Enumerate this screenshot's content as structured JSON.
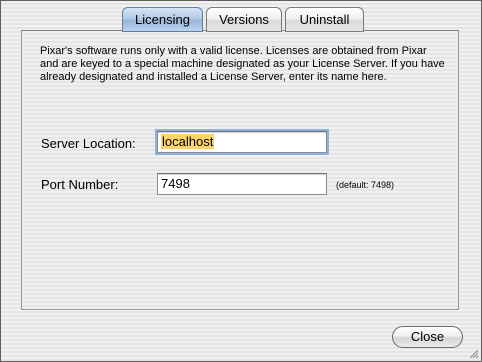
{
  "tabs": [
    {
      "label": "Licensing",
      "active": true
    },
    {
      "label": "Versions",
      "active": false
    },
    {
      "label": "Uninstall",
      "active": false
    }
  ],
  "licensing": {
    "info_text": "Pixar's software runs only with a valid license.  Licenses are obtained from Pixar and are keyed to a special machine designated as your License Server.  If you have already designated and installed a License Server, enter its name here.",
    "server_location": {
      "label": "Server Location:",
      "value": "localhost"
    },
    "port_number": {
      "label": "Port Number:",
      "value": "7498",
      "default_note": "(default: 7498)"
    }
  },
  "footer": {
    "close_label": "Close"
  },
  "colors": {
    "active_tab": "#a9c4e4",
    "selection_highlight": "#ffd36b",
    "focus_ring": "#8fb2e0"
  }
}
